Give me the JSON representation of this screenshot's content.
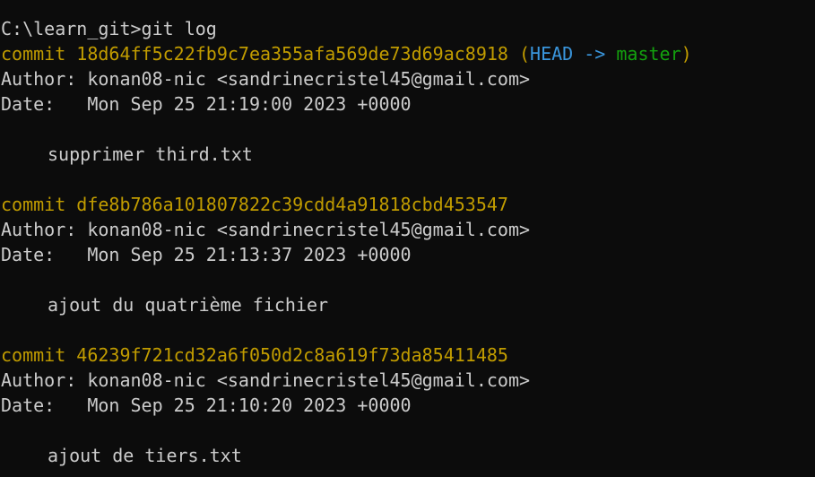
{
  "prompt": {
    "path": "C:\\learn_git>",
    "command": "git log"
  },
  "commits": [
    {
      "label": "commit",
      "hash": "18d64ff5c22fb9c7ea355afa569de73d69ac8918",
      "ref_open": "(",
      "head": "HEAD",
      "arrow": " -> ",
      "branch": "master",
      "ref_close": ")",
      "author_label": "Author:",
      "author": "konan08-nic <sandrinecristel45@gmail.com>",
      "date_label": "Date:",
      "date": "Mon Sep 25 21:19:00 2023 +0000",
      "message": "supprimer third.txt"
    },
    {
      "label": "commit",
      "hash": "dfe8b786a101807822c39cdd4a91818cbd453547",
      "author_label": "Author:",
      "author": "konan08-nic <sandrinecristel45@gmail.com>",
      "date_label": "Date:",
      "date": "Mon Sep 25 21:13:37 2023 +0000",
      "message": "ajout du quatrième fichier"
    },
    {
      "label": "commit",
      "hash": "46239f721cd32a6f050d2c8a619f73da85411485",
      "author_label": "Author:",
      "author": "konan08-nic <sandrinecristel45@gmail.com>",
      "date_label": "Date:",
      "date": "Mon Sep 25 21:10:20 2023 +0000",
      "message": "ajout de tiers.txt"
    }
  ],
  "colors": {
    "background": "#0c0c0c",
    "text": "#cccccc",
    "commit": "#c19c00",
    "head": "#3a96dd",
    "branch": "#13a10e"
  }
}
